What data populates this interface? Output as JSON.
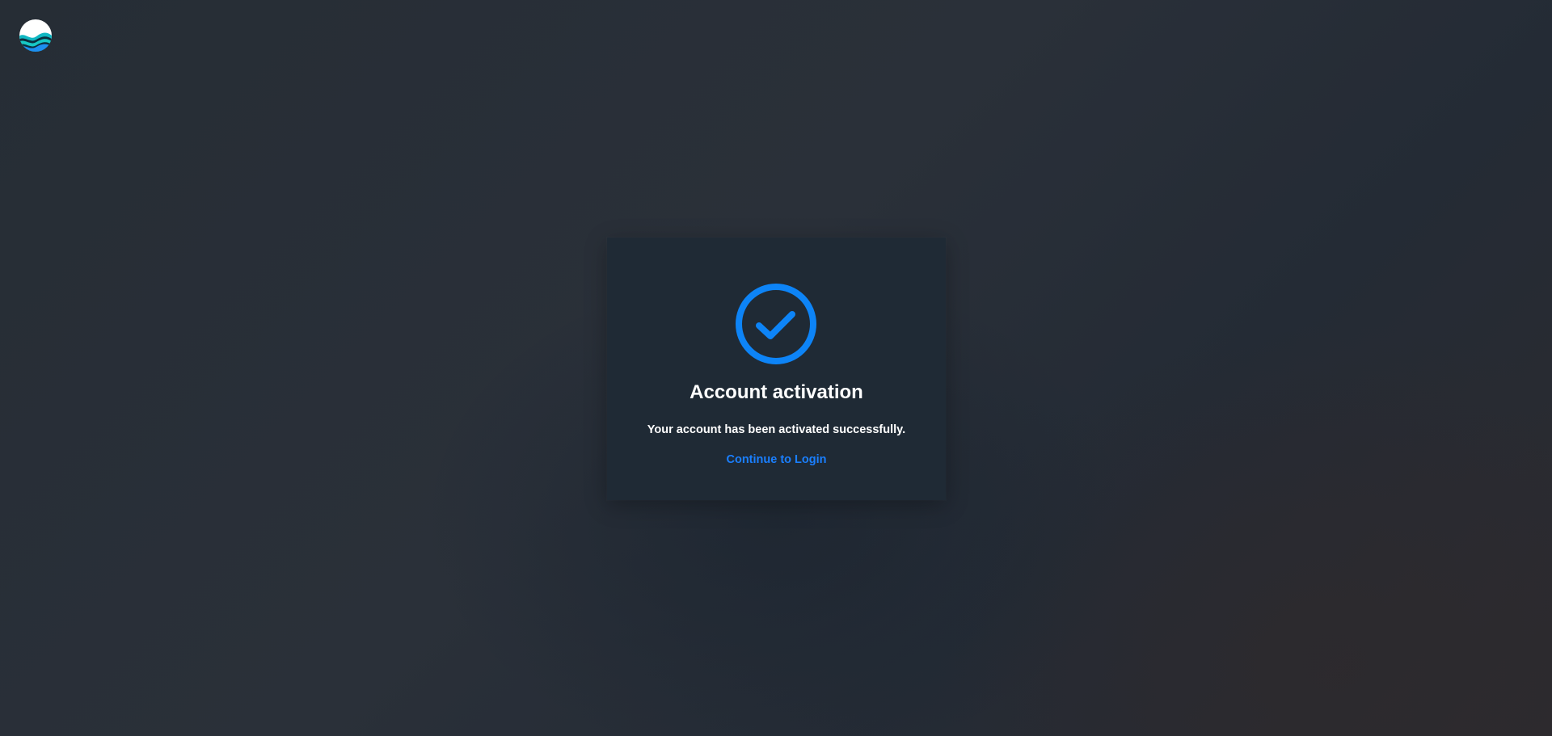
{
  "brand": {
    "logo_icon": "wave-globe-logo",
    "colors": {
      "logo_light": "#ffffff",
      "logo_teal": "#14c7c4",
      "logo_blue": "#1c8cf0"
    }
  },
  "card": {
    "icon": "check-circle-icon",
    "title": "Account activation",
    "message": "Your account has been activated successfully.",
    "continue_link": "Continue to Login"
  },
  "colors": {
    "accent": "#0d84f7",
    "link": "#1a7fff",
    "card_background": "#1f2a35",
    "text": "#ffffff"
  }
}
